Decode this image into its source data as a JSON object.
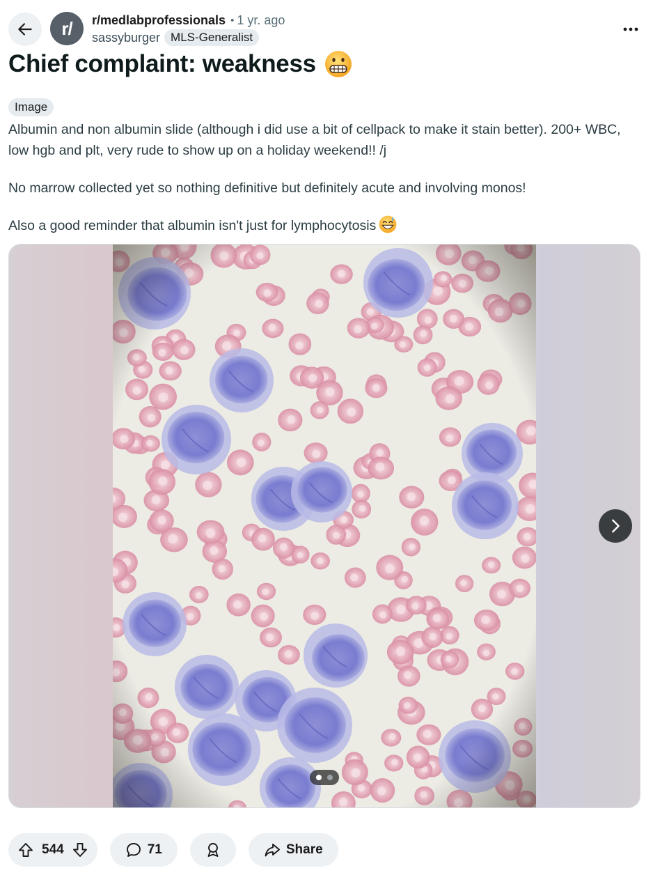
{
  "post": {
    "subreddit": "r/medlabprofessionals",
    "avatar_text": "r/",
    "separator": "•",
    "age": "1 yr. ago",
    "author": "sassyburger",
    "flair": "MLS-Generalist",
    "title": "Chief complaint: weakness",
    "tag": "Image",
    "body": [
      "Albumin and non albumin slide (although i did use a bit of cellpack to make it stain better). 200+ WBC, low hgb and plt, very rude to show up on a holiday weekend!! /j",
      "No marrow collected yet so nothing definitive but definitely acute and involving monos!",
      "Also a good reminder that albumin isn't just for lymphocytosis"
    ]
  },
  "gallery": {
    "count": 2,
    "current": 1
  },
  "actions": {
    "votes": "544",
    "comments": "71",
    "share_label": "Share"
  },
  "icons": {
    "back": "arrow-left-icon",
    "more": "ellipsis-icon",
    "title_emoji": "grimacing-face-emoji",
    "body_emoji": "grinning-sweat-emoji",
    "next": "chevron-right-icon",
    "upvote": "upvote-arrow-icon",
    "downvote": "downvote-arrow-icon",
    "comment": "comment-bubble-icon",
    "award": "award-icon",
    "share": "share-arrow-icon"
  },
  "colors": {
    "pill_bg": "#eef1f3",
    "avatar_bg": "#576069",
    "cell_purple": "#7c7fd2",
    "rbc_pink": "#e0a7b6"
  }
}
